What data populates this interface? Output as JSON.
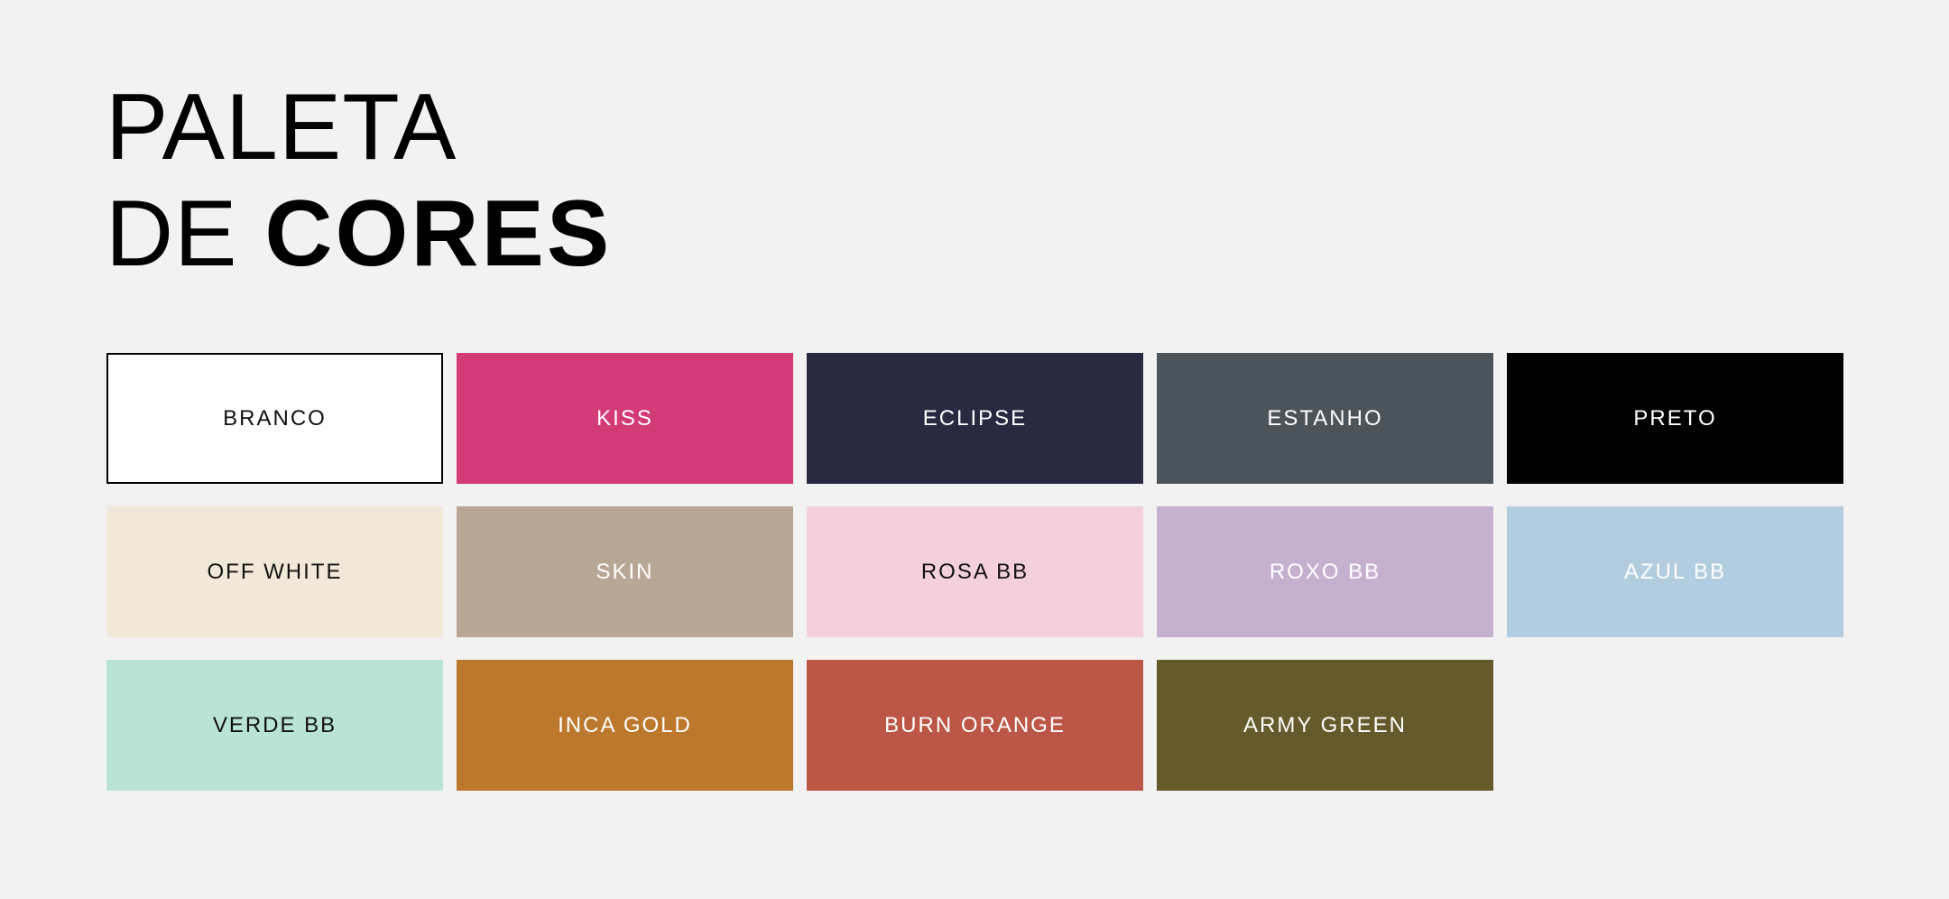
{
  "title": {
    "line1": "PALETA",
    "line2_light": "DE",
    "line2_bold": "CORES"
  },
  "swatches": [
    {
      "label": "BRANCO",
      "color": "#ffffff",
      "text_color": "#111111",
      "outlined": true
    },
    {
      "label": "KISS",
      "color": "#d33a78",
      "text_color": "#ffffff"
    },
    {
      "label": "ECLIPSE",
      "color": "#292a42",
      "text_color": "#ffffff"
    },
    {
      "label": "ESTANHO",
      "color": "#4b535b",
      "text_color": "#ffffff"
    },
    {
      "label": "PRETO",
      "color": "#000000",
      "text_color": "#ffffff"
    },
    {
      "label": "OFF WHITE",
      "color": "#f2e8da",
      "text_color": "#111111"
    },
    {
      "label": "SKIN",
      "color": "#b9a795",
      "text_color": "#ffffff"
    },
    {
      "label": "ROSA BB",
      "color": "#f4d0dc",
      "text_color": "#111111"
    },
    {
      "label": "ROXO BB",
      "color": "#c5b1cf",
      "text_color": "#ffffff"
    },
    {
      "label": "AZUL BB",
      "color": "#b3cde0",
      "text_color": "#ffffff"
    },
    {
      "label": "VERDE BB",
      "color": "#b9e3d4",
      "text_color": "#111111"
    },
    {
      "label": "INCA GOLD",
      "color": "#bc792e",
      "text_color": "#ffffff"
    },
    {
      "label": "BURN ORANGE",
      "color": "#bc5646",
      "text_color": "#ffffff"
    },
    {
      "label": "ARMY GREEN",
      "color": "#645a2b",
      "text_color": "#ffffff"
    }
  ]
}
